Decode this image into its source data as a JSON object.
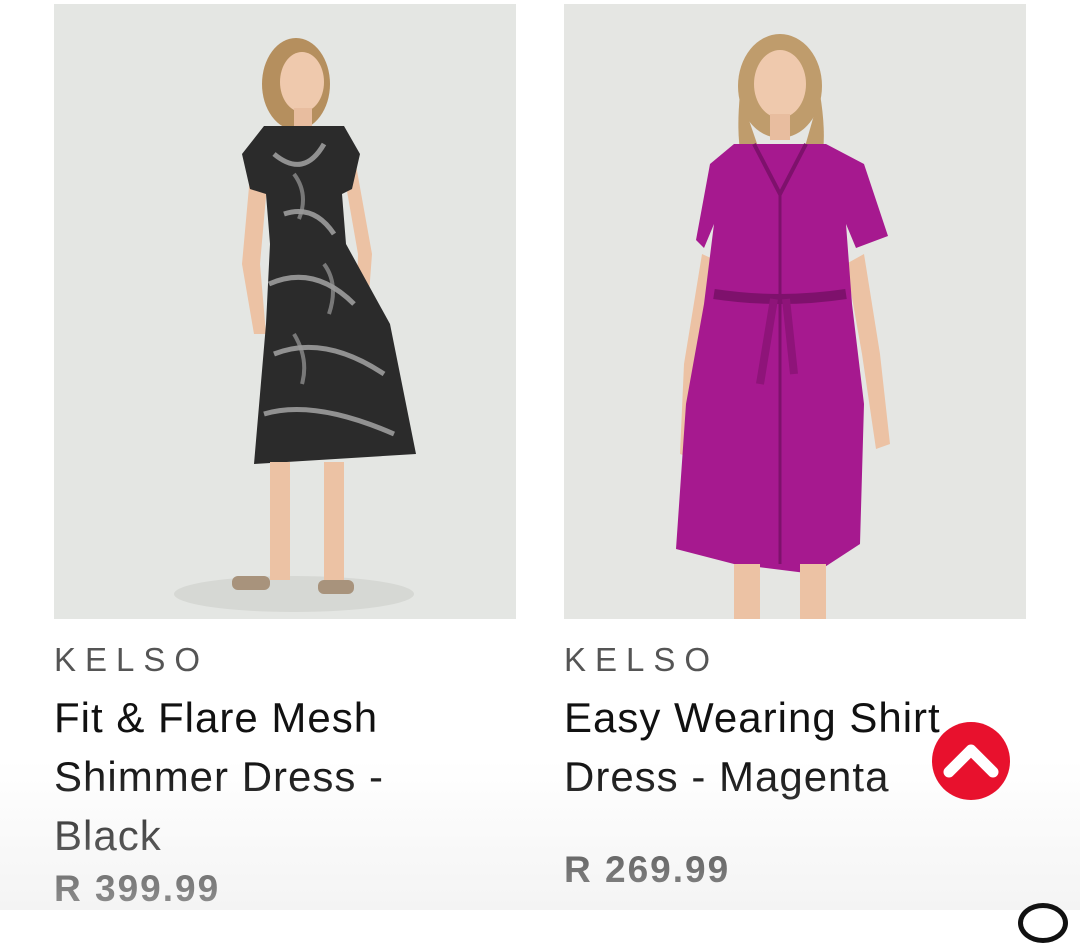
{
  "products": [
    {
      "brand": "KELSO",
      "title_lines": [
        "Fit & Flare Mesh",
        "Shimmer Dress -",
        "Black"
      ],
      "price": "R 399.99",
      "image_color": "#2b2b2b"
    },
    {
      "brand": "KELSO",
      "title_lines": [
        "Easy Wearing Shirt",
        "Dress - Magenta"
      ],
      "price": "R 269.99",
      "image_color": "#a6198f"
    }
  ],
  "scroll_top": {
    "icon": "chevron-up-icon",
    "color": "#e8112d"
  }
}
